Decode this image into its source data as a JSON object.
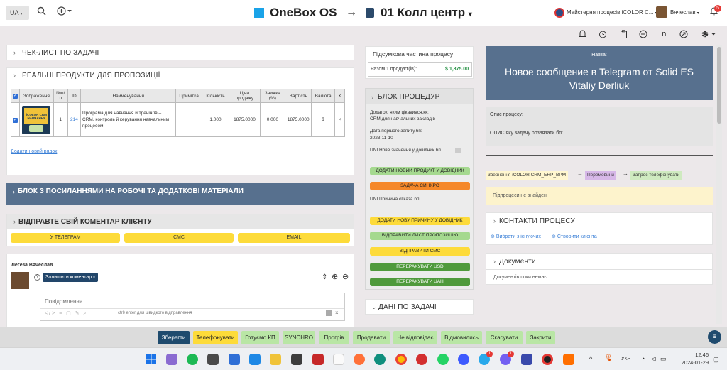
{
  "topbar": {
    "lang": "UA",
    "brand": "OneBox OS",
    "arrow": "→",
    "process_title": "01 Колл центр",
    "company": "Майстерня процесів iCOLOR C...",
    "user": "Вячеслав",
    "notif_count": "5"
  },
  "checklist": {
    "title": "ЧЕК-ЛИСТ ПО ЗАДАЧІ"
  },
  "products": {
    "title": "РЕАЛЬНІ ПРОДУКТИ ДЛЯ ПРОПОЗИЦІЇ",
    "headers": [
      "",
      "Зображення",
      "№п/п",
      "ID",
      "Найменування",
      "Примітка",
      "Кількість",
      "Ціна продажу",
      "Знижка (%)",
      "Вартість",
      "Валюта",
      "X"
    ],
    "row": {
      "num": "1",
      "id": "214",
      "name": "Програма для навчання й тренінгів – CRM, контроль й керування навчальним процесом",
      "note": "",
      "qty": "1.000",
      "price": "1875,0000",
      "discount": "0,000",
      "cost": "1875,0000",
      "currency": "$",
      "remove": "×",
      "img_text": "iCOLOR CRM НАВЧАННЯ"
    },
    "add_link": "Додати новий рядок"
  },
  "links_block": {
    "title": "БЛОК З ПОСИЛАННЯМИ НА РОБОЧІ ТА ДОДАТКОВІ МАТЕРІАЛИ"
  },
  "comment_block": {
    "title": "ВІДПРАВТЕ СВІЙ КОМЕНТАР КЛІЄНТУ",
    "buttons": [
      "У ТЕЛЕГРАМ",
      "СМС",
      "EMAIL"
    ]
  },
  "comment": {
    "author": "Легеза Вячеслав",
    "help": "?",
    "leave_btn": "Залишити коментар",
    "placeholder": "Повідомлення",
    "hint": "ctrl+enter для швидкого відправлення"
  },
  "summary": {
    "title": "Підсумкова частина процесу",
    "total_label": "Разом 1 продукт(ів):",
    "total_value": "$ 1,875.00"
  },
  "procedures": {
    "title": "БЛОК ПРОЦЕДУР",
    "field1_label": "Додаток, яким цікавився.кк:",
    "field1_value": "CRM для навчальних закладів",
    "field2_label": "Дата першого запиту.бп:",
    "field2_value": "2023-11-10",
    "field3_label": "UNI Нове значення у довідник.бп",
    "btn_add_product": "ДОДАТИ НОВИЙ ПРОДУКТ У ДОВІДНИК",
    "btn_sync": "ЗАДАЧА СИНХРО",
    "field4_label": "UNI Причина отказа.бп:",
    "btn_add_reason": "ДОДАТИ НОВУ ПРИЧИНУ У ДОВІДНИК",
    "btn_send_offer": "ВІДПРАВИТИ ЛИСТ ПРОПОЗИЦІЮ",
    "btn_send_sms": "ВІДПРАВИТИ СМС",
    "btn_usd": "ПЕРЕРАХУВАТИ USD",
    "btn_uah": "ПЕРЕРАХУВАТИ UAH"
  },
  "task_data": {
    "title": "ДАНІ ПО ЗАДАЧІ"
  },
  "right": {
    "name_label": "Назва:",
    "name_value": "Новое сообщение в Telegram от Solid ES Vitaliy Derliuk",
    "desc_label": "Опис процесу:",
    "desc_value": "ОПИС яку задачу розвязати.бп:",
    "flow": [
      "Звернення iCOLOR CRM_ERP_BPM",
      "Перемовини",
      "Запрос телефонувати"
    ],
    "no_subprocess": "Підпроцеси не знайдені",
    "contacts_title": "КОНТАКТИ ПРОЦЕСУ",
    "choose_existing": "Вибрати з існуючих",
    "create_client": "Створити клієнта",
    "docs_title": "Документи",
    "no_docs": "Документів поки немає."
  },
  "statusbar": {
    "buttons": [
      "Зберегти",
      "Телефонувати",
      "Готуємо КП",
      "SYNCHRO",
      "Прогрів",
      "Продавати",
      "Не відповідає",
      "Відмовились",
      "Скасувати",
      "Закрити"
    ]
  },
  "taskbar": {
    "lang": "УКР",
    "time": "12:46",
    "date": "2024-01-29",
    "badge1": "1",
    "badge2": "1"
  },
  "colors": {
    "brand_blue": "#1aa3e8",
    "header_slate": "#57708e",
    "save_blue": "#1f4b6e",
    "status_green": "#b9e6a5",
    "phone_yellow": "#fddb3a"
  }
}
